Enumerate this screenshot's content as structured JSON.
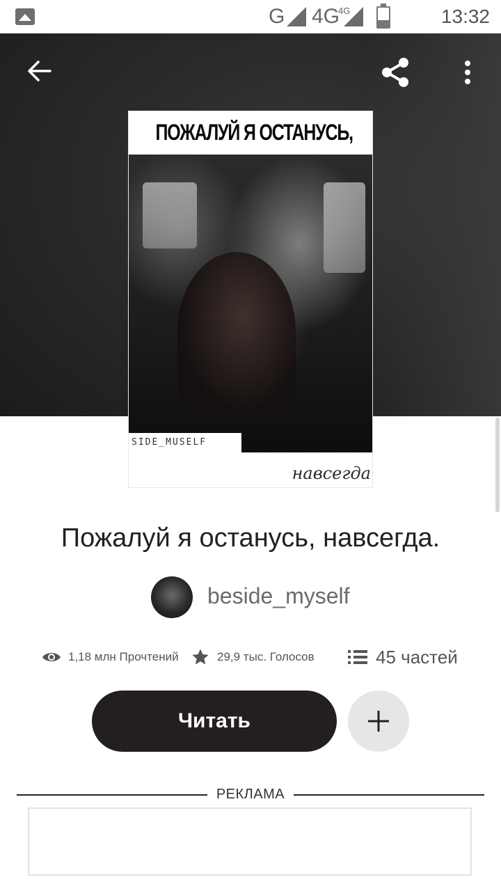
{
  "status_bar": {
    "net1": "G",
    "net2": "4G",
    "net2_sup": "4G",
    "time": "13:32"
  },
  "toolbar": {
    "back_icon": "arrow-left-icon",
    "share_icon": "share-icon",
    "more_icon": "more-vert-icon"
  },
  "cover": {
    "title": "ПОЖАЛУЙ Я ОСТАНУСЬ,",
    "author_tag": "SIDE_MUSELF",
    "script_word": "навсегда"
  },
  "story": {
    "title": "Пожалуй я останусь, навсегда.",
    "author": "beside_myself"
  },
  "stats": {
    "reads": "1,18 млн Прочтений",
    "votes": "29,9 тыс. Голосов",
    "parts": "45 частей"
  },
  "actions": {
    "read_label": "Читать",
    "add_icon": "plus-icon"
  },
  "ad": {
    "label": "РЕКЛАМА"
  },
  "colors": {
    "read_button_bg": "#231f20",
    "add_button_bg": "#e6e6e6",
    "hero_bg": "#2a2a2a"
  }
}
